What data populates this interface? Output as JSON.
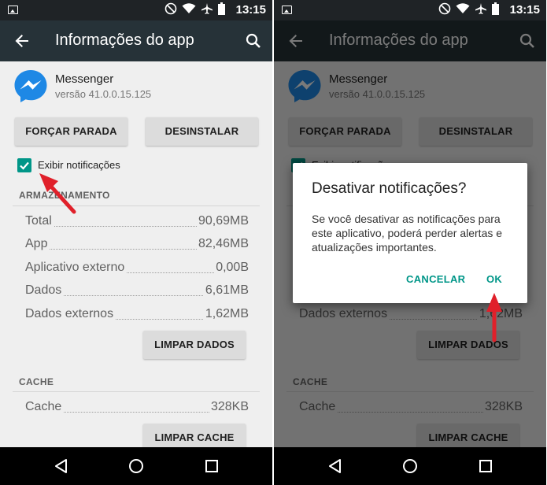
{
  "status_bar": {
    "time": "13:15"
  },
  "app_bar": {
    "title": "Informações do app"
  },
  "app": {
    "name": "Messenger",
    "version": "versão 41.0.0.15.125"
  },
  "actions": {
    "force_stop": "FORÇAR PARADA",
    "uninstall": "DESINSTALAR"
  },
  "notifications": {
    "label": "Exibir notificações",
    "checked": true
  },
  "storage": {
    "heading": "ARMAZENAMENTO",
    "rows": [
      {
        "label": "Total",
        "value": "90,69MB"
      },
      {
        "label": "App",
        "value": "82,46MB"
      },
      {
        "label": "Aplicativo externo",
        "value": "0,00B"
      },
      {
        "label": "Dados",
        "value": "6,61MB"
      },
      {
        "label": "Dados externos",
        "value": "1,62MB"
      }
    ],
    "clear_button": "LIMPAR DADOS"
  },
  "cache": {
    "heading": "CACHE",
    "rows": [
      {
        "label": "Cache",
        "value": "328KB"
      }
    ],
    "clear_button": "LIMPAR CACHE"
  },
  "dialog": {
    "title": "Desativar notificações?",
    "message": "Se você desativar as notificações para este aplicativo, poderá perder alertas e atualizações importantes.",
    "cancel": "CANCELAR",
    "ok": "OK"
  },
  "colors": {
    "accent": "#009688",
    "toolbar": "#263238",
    "status_bar": "#1f2326",
    "annotation_arrow": "#e0202a"
  },
  "icons": [
    "image-icon",
    "no-disturb-icon",
    "wifi-icon",
    "airplane-icon",
    "battery-icon",
    "back-arrow-icon",
    "search-icon",
    "messenger-icon",
    "nav-back-icon",
    "nav-home-icon",
    "nav-recents-icon"
  ]
}
